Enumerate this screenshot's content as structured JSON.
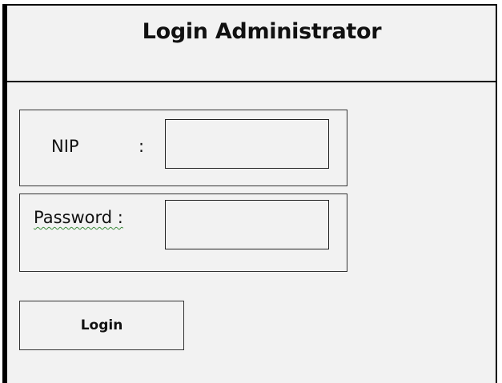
{
  "header": {
    "title": "Login Administrator"
  },
  "form": {
    "nip": {
      "label": "NIP",
      "separator": ":",
      "value": ""
    },
    "password": {
      "label": "Password",
      "separator": ":",
      "value": ""
    },
    "submit_label": "Login"
  },
  "colors": {
    "background": "#f2f2f2",
    "border": "#000000",
    "spellcheck_underline": "#3a8a3a"
  }
}
